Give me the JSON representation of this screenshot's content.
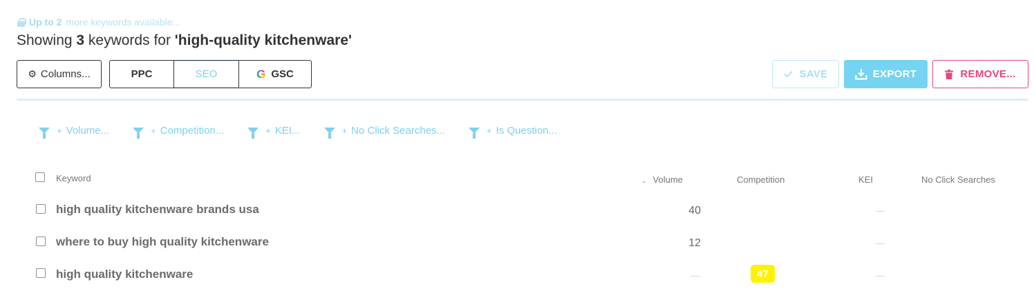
{
  "upgrade_notice": {
    "bold": "Up to 2",
    "rest": "more keywords available..."
  },
  "heading": {
    "prefix": "Showing ",
    "count": "3",
    "middle": " keywords for ",
    "query": "'high-quality kitchenware'"
  },
  "toolbar": {
    "columns_label": "Columns...",
    "tabs": [
      {
        "label": "PPC",
        "active": false
      },
      {
        "label": "SEO",
        "active": true
      },
      {
        "label": "GSC",
        "active": false
      }
    ],
    "google_glyph": "G",
    "save_label": "SAVE",
    "export_label": "EXPORT",
    "remove_label": "REMOVE..."
  },
  "filters": [
    "Volume...",
    "Competition...",
    "KEI...",
    "No Click Searches...",
    "Is Question..."
  ],
  "table": {
    "columns": {
      "keyword": "Keyword",
      "volume": "Volume",
      "competition": "Competition",
      "kei": "KEI",
      "no_click": "No Click Searches"
    },
    "rows": [
      {
        "keyword": "high quality kitchenware brands usa",
        "volume": "40",
        "competition": "",
        "kei": "—"
      },
      {
        "keyword": "where to buy high quality kitchenware",
        "volume": "12",
        "competition": "",
        "kei": "—"
      },
      {
        "keyword": "high quality kitchenware",
        "volume": "—",
        "competition": "47",
        "kei": "—"
      }
    ]
  },
  "colors": {
    "accent": "#74d4f2",
    "danger": "#e8437d",
    "competition_badge": "#fff200"
  }
}
